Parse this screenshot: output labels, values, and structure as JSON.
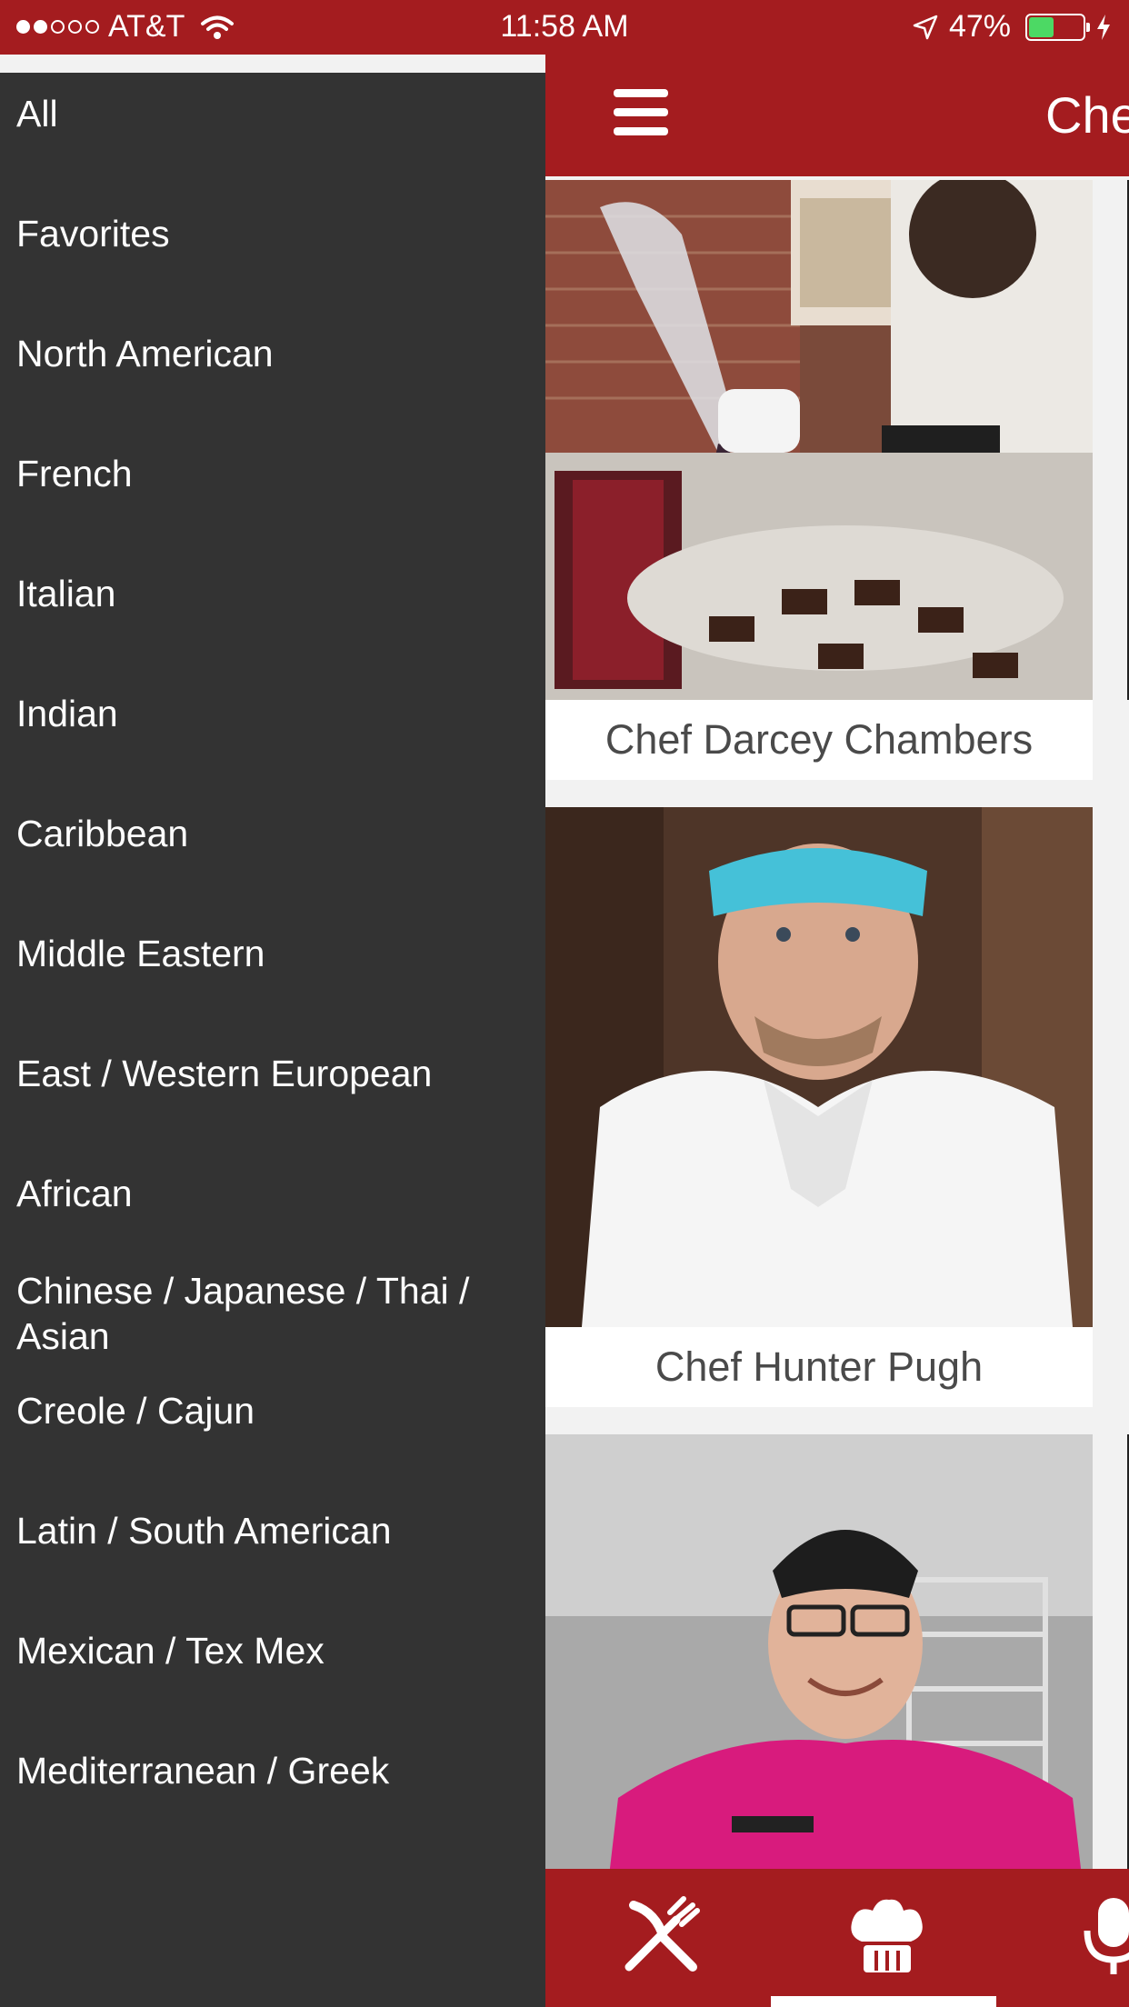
{
  "status_bar": {
    "carrier": "AT&T",
    "time": "11:58 AM",
    "battery_percent": "47%",
    "battery_level": 0.47,
    "signal_bars_filled": 2,
    "signal_bars_total": 5
  },
  "header": {
    "title": "Che"
  },
  "drawer": {
    "items": [
      "All",
      "Favorites",
      "North American",
      "French",
      "Italian",
      "Indian",
      "Caribbean",
      "Middle Eastern",
      "East / Western European",
      "African",
      "Chinese / Japanese / Thai / Asian",
      "Creole / Cajun",
      "Latin / South American",
      "Mexican / Tex Mex",
      "Mediterranean / Greek"
    ]
  },
  "chefs": [
    {
      "name": "Chef Darcey Chambers"
    },
    {
      "name": "Chef Hunter Pugh"
    },
    {
      "name": ""
    }
  ],
  "tabs": [
    {
      "icon": "fork-knife-icon"
    },
    {
      "icon": "chef-hat-icon"
    },
    {
      "icon": "microphone-icon"
    }
  ],
  "colors": {
    "brand_red": "#a41c1f",
    "drawer_bg": "#333333",
    "battery_green": "#4cd964"
  }
}
